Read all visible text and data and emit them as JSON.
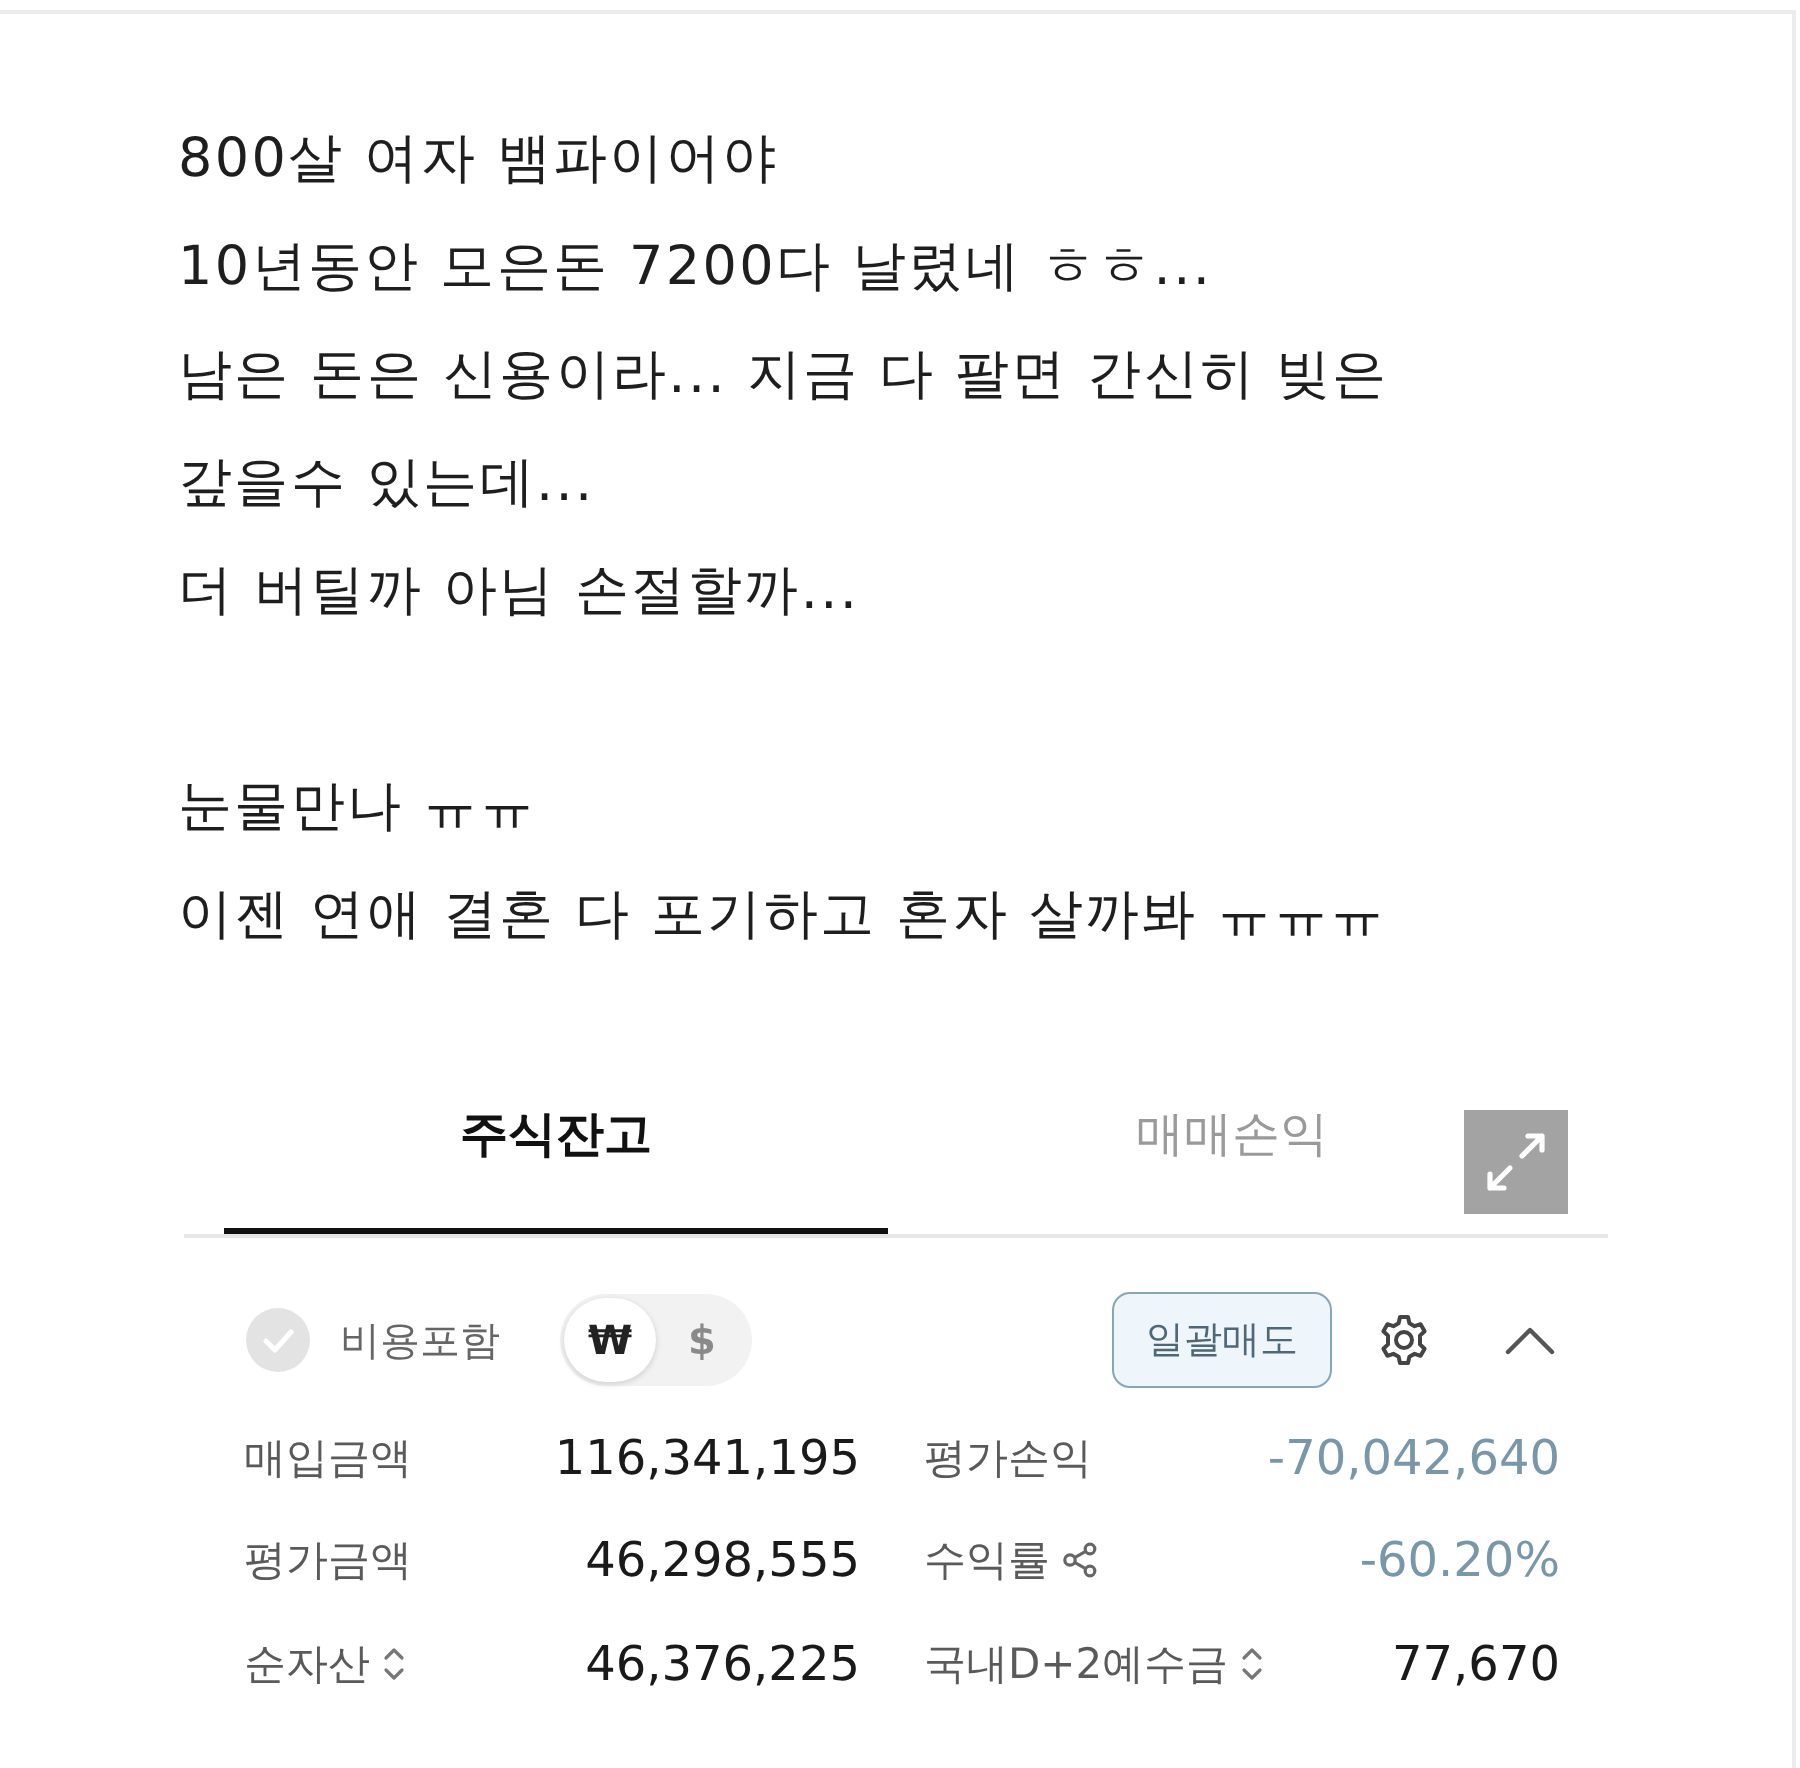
{
  "post": {
    "paragraphs": [
      {
        "lines": [
          "800살 여자 뱀파이어야",
          "10년동안 모은돈 7200다 날렸네 ㅎㅎ...",
          "남은 돈은 신용이라... 지금 다 팔면 간신히 빚은",
          "갚을수 있는데...",
          "더 버틸까 아님 손절할까..."
        ]
      },
      {
        "lines": [
          "눈물만나 ㅠㅠ",
          "이젠 연애 결혼 다 포기하고 혼자 살까봐 ㅠㅠㅠ"
        ]
      }
    ]
  },
  "account_panel": {
    "tabs": [
      {
        "label": "주식잔고",
        "selected": true
      },
      {
        "label": "매매손익",
        "selected": false
      }
    ],
    "cost_option": {
      "label": "비용포함",
      "checked": false
    },
    "currency_toggle": [
      {
        "label": "₩",
        "selected": true
      },
      {
        "label": "$",
        "selected": false
      }
    ],
    "bulk_sell_button": "일괄매도",
    "expanded": true,
    "summary": [
      {
        "label": "매입금액",
        "value": "116,341,195",
        "kind": "plain",
        "negative": false
      },
      {
        "label": "평가손익",
        "value": "-70,042,640",
        "kind": "plain",
        "negative": true
      },
      {
        "label": "평가금액",
        "value": "46,298,555",
        "kind": "plain",
        "negative": false
      },
      {
        "label": "수익률",
        "value": "-60.20%",
        "kind": "share",
        "negative": true
      },
      {
        "label": "순자산",
        "value": "46,376,225",
        "kind": "sort",
        "negative": false
      },
      {
        "label": "국내D+2예수금",
        "value": "77,670",
        "kind": "sort",
        "negative": false
      }
    ]
  }
}
